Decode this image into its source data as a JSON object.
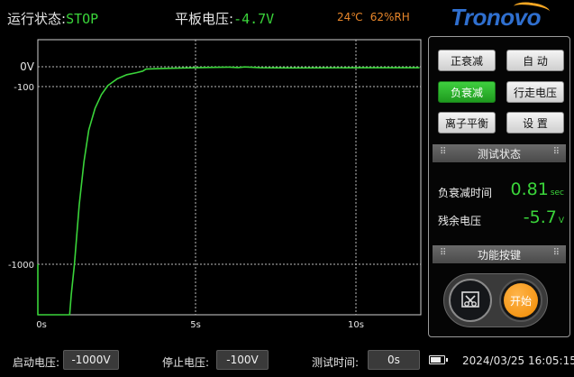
{
  "header": {
    "status_label": "运行状态:",
    "status_value": "STOP",
    "voltage_label": "平板电压:",
    "voltage_value": "-4.7V",
    "temperature": "24℃",
    "humidity": "62%RH",
    "logo_text": "Tronovo"
  },
  "chart_data": {
    "type": "line",
    "title": "",
    "xlabel": "",
    "ylabel": "",
    "x_ticks": [
      "0s",
      "5s",
      "10s"
    ],
    "y_ticks": [
      "0V",
      "-100",
      "-1000"
    ],
    "grid": true,
    "series": [
      {
        "color": "#3ad43a",
        "points": [
          [
            0.0,
            -1000
          ],
          [
            0.0,
            -1500
          ],
          [
            1.0,
            -1500
          ],
          [
            1.05,
            -1300
          ],
          [
            1.15,
            -1000
          ],
          [
            1.3,
            -700
          ],
          [
            1.45,
            -480
          ],
          [
            1.6,
            -320
          ],
          [
            1.8,
            -210
          ],
          [
            2.0,
            -140
          ],
          [
            2.2,
            -95
          ],
          [
            2.5,
            -60
          ],
          [
            2.8,
            -40
          ],
          [
            3.1,
            -30
          ],
          [
            3.3,
            -22
          ],
          [
            3.4,
            -12
          ],
          [
            4.0,
            -8
          ],
          [
            5.0,
            -5
          ],
          [
            5.5,
            -3
          ],
          [
            6.0,
            -2
          ],
          [
            6.3,
            -4
          ],
          [
            6.5,
            -1
          ],
          [
            7.0,
            -5
          ],
          [
            8.0,
            -6
          ],
          [
            10.0,
            -5
          ],
          [
            12.0,
            -5
          ]
        ]
      }
    ]
  },
  "buttons": {
    "pos_decay": "正衰减",
    "auto": "自 动",
    "neg_decay": "负衰减",
    "walk_voltage": "行走电压",
    "ion_balance": "离子平衡",
    "settings": "设 置"
  },
  "test_status": {
    "title": "测试状态",
    "decay_time_label": "负衰减时间",
    "decay_time_value": "0.81",
    "decay_time_unit": "sec",
    "residual_label": "残余电压",
    "residual_value": "-5.7",
    "residual_unit": "V"
  },
  "function_keys": {
    "title": "功能按键",
    "start_label": "开始"
  },
  "footer": {
    "start_voltage_label": "启动电压:",
    "start_voltage_value": "-1000V",
    "stop_voltage_label": "停止电压:",
    "stop_voltage_value": "-100V",
    "test_time_label": "测试时间:",
    "test_time_value": "0s",
    "battery_level": 0.7,
    "datetime": "2024/03/25 16:05:15"
  },
  "colors": {
    "accent_green": "#3ad43a",
    "accent_orange": "#f08a00",
    "logo_blue": "#2f6fcf"
  }
}
